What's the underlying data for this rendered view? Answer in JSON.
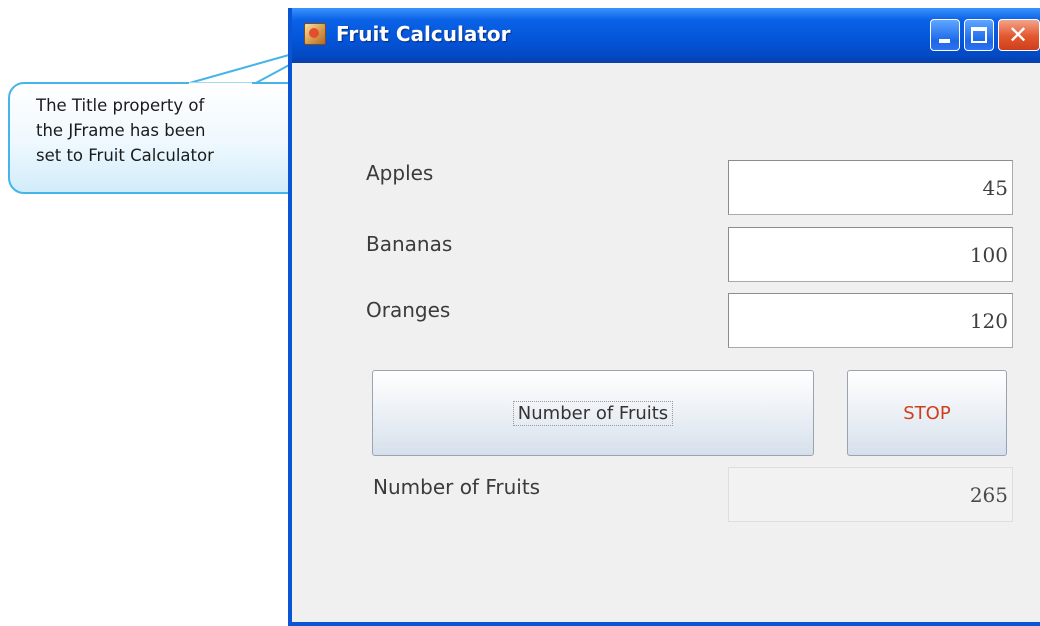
{
  "callout": {
    "lines": [
      "The Title property of",
      "the JFrame has been",
      "set to Fruit Calculator"
    ]
  },
  "window": {
    "title": "Fruit Calculator",
    "icon": "java-app-icon",
    "controls": {
      "minimize": "minimize-icon",
      "maximize": "maximize-icon",
      "close": "close-icon"
    }
  },
  "form": {
    "fields": [
      {
        "label": "Apples",
        "value": "45"
      },
      {
        "label": "Bananas",
        "value": "100"
      },
      {
        "label": "Oranges",
        "value": "120"
      }
    ],
    "buttons": {
      "calculate_label": "Number of Fruits",
      "stop_label": "STOP"
    },
    "result": {
      "label": "Number of Fruits",
      "value": "265"
    }
  },
  "colors": {
    "titlebar": "#0454d8",
    "callout_border": "#46b4e8",
    "stop_text": "#cc3f1d"
  }
}
